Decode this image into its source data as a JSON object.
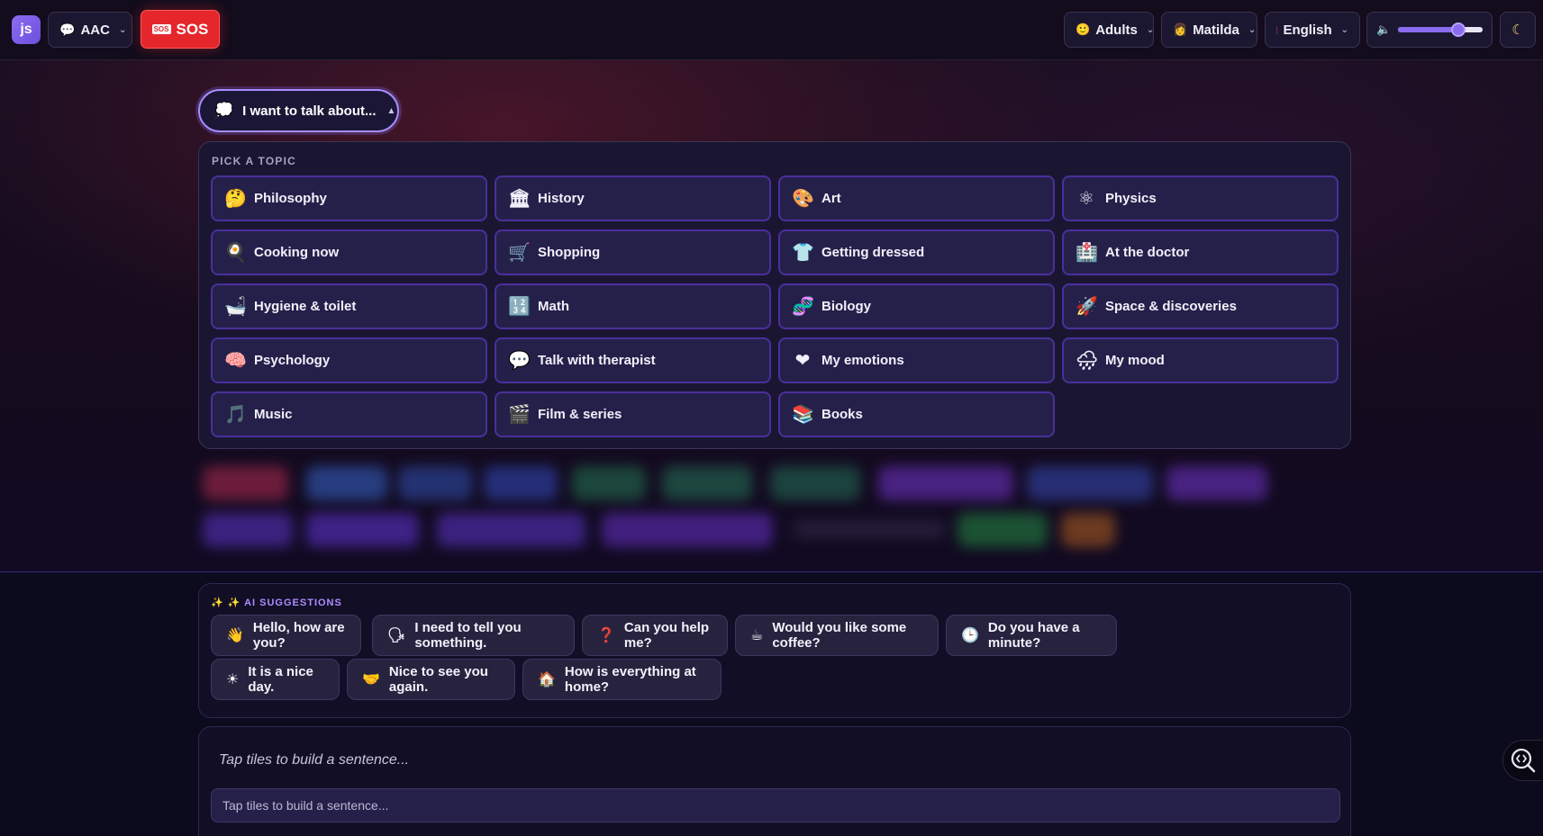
{
  "topbar": {
    "logo_text": "js",
    "mode": {
      "icon": "speech-bubble-icon",
      "label": "AAC"
    },
    "sos": {
      "badge": "SOS",
      "label": "SOS",
      "color": "#e5262b"
    },
    "audience": {
      "icon": "face-icon",
      "label": "Adults"
    },
    "voice": {
      "icon": "person-icon",
      "label": "Matilda"
    },
    "language": {
      "icon": "flag-icon",
      "label": "English"
    },
    "volume": {
      "icon": "speaker-muted-icon",
      "level_percent": 68
    },
    "theme_toggle": {
      "icon": "moon-icon"
    }
  },
  "topic_trigger": {
    "icon": "thought-bubble-icon",
    "label": "I want to talk about..."
  },
  "topic_panel": {
    "heading": "PICK A TOPIC",
    "topics": [
      {
        "icon": "🤔",
        "label": "Philosophy"
      },
      {
        "icon": "🏛",
        "label": "History"
      },
      {
        "icon": "🎨",
        "label": "Art"
      },
      {
        "icon": "⚛",
        "label": "Physics"
      },
      {
        "icon": "🍳",
        "label": "Cooking now"
      },
      {
        "icon": "🛒",
        "label": "Shopping"
      },
      {
        "icon": "👕",
        "label": "Getting dressed"
      },
      {
        "icon": "🏥",
        "label": "At the doctor"
      },
      {
        "icon": "🛁",
        "label": "Hygiene & toilet"
      },
      {
        "icon": "🔢",
        "label": "Math"
      },
      {
        "icon": "🧬",
        "label": "Biology"
      },
      {
        "icon": "🚀",
        "label": "Space & discoveries"
      },
      {
        "icon": "🧠",
        "label": "Psychology"
      },
      {
        "icon": "💬",
        "label": "Talk with therapist"
      },
      {
        "icon": "❤",
        "label": "My emotions"
      },
      {
        "icon": "🌧",
        "label": "My mood"
      },
      {
        "icon": "🎵",
        "label": "Music"
      },
      {
        "icon": "🎬",
        "label": "Film & series"
      },
      {
        "icon": "📚",
        "label": "Books"
      }
    ]
  },
  "ai_suggestions": {
    "heading": "✨ ✨ AI SUGGESTIONS",
    "items": [
      {
        "icon": "👋",
        "label": "Hello, how are you?"
      },
      {
        "icon": "🗣",
        "label": "I need to tell you something."
      },
      {
        "icon": "❓",
        "label": "Can you help me?"
      },
      {
        "icon": "☕",
        "label": "Would you like some coffee?"
      },
      {
        "icon": "🕒",
        "label": "Do you have a minute?"
      },
      {
        "icon": "☀",
        "label": "It is a nice day."
      },
      {
        "icon": "🤝",
        "label": "Nice to see you again."
      },
      {
        "icon": "🏠",
        "label": "How is everything at home?"
      }
    ]
  },
  "composer": {
    "placeholder_text": "Tap tiles to build a sentence...",
    "input_placeholder": "Tap tiles to build a sentence..."
  },
  "inspector": {
    "icon": "inspect-code-icon"
  }
}
